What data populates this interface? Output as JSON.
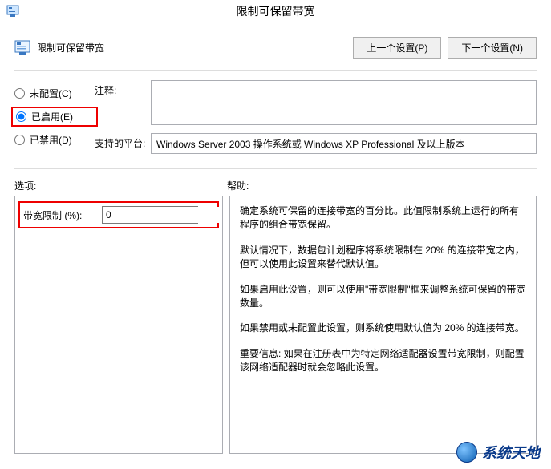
{
  "titlebar": {
    "title": "限制可保留带宽"
  },
  "header": {
    "setting_name": "限制可保留带宽",
    "prev_button": "上一个设置(P)",
    "next_button": "下一个设置(N)"
  },
  "radios": {
    "not_configured": "未配置(C)",
    "enabled": "已启用(E)",
    "disabled": "已禁用(D)",
    "selected": "enabled"
  },
  "comment": {
    "label": "注释:",
    "value": ""
  },
  "platform": {
    "label": "支持的平台:",
    "value": "Windows Server 2003 操作系统或 Windows XP Professional 及以上版本"
  },
  "panel_labels": {
    "options": "选项:",
    "help": "帮助:"
  },
  "options": {
    "bandwidth_label": "带宽限制 (%):",
    "bandwidth_value": "0"
  },
  "help": {
    "p1": "确定系统可保留的连接带宽的百分比。此值限制系统上运行的所有程序的组合带宽保留。",
    "p2": "默认情况下，数据包计划程序将系统限制在 20% 的连接带宽之内，但可以使用此设置来替代默认值。",
    "p3": "如果启用此设置，则可以使用\"带宽限制\"框来调整系统可保留的带宽数量。",
    "p4": "如果禁用或未配置此设置，则系统使用默认值为 20% 的连接带宽。",
    "p5": "重要信息: 如果在注册表中为特定网络适配器设置带宽限制，则配置该网络适配器时就会忽略此设置。"
  },
  "watermark": {
    "text": "系统天地"
  }
}
